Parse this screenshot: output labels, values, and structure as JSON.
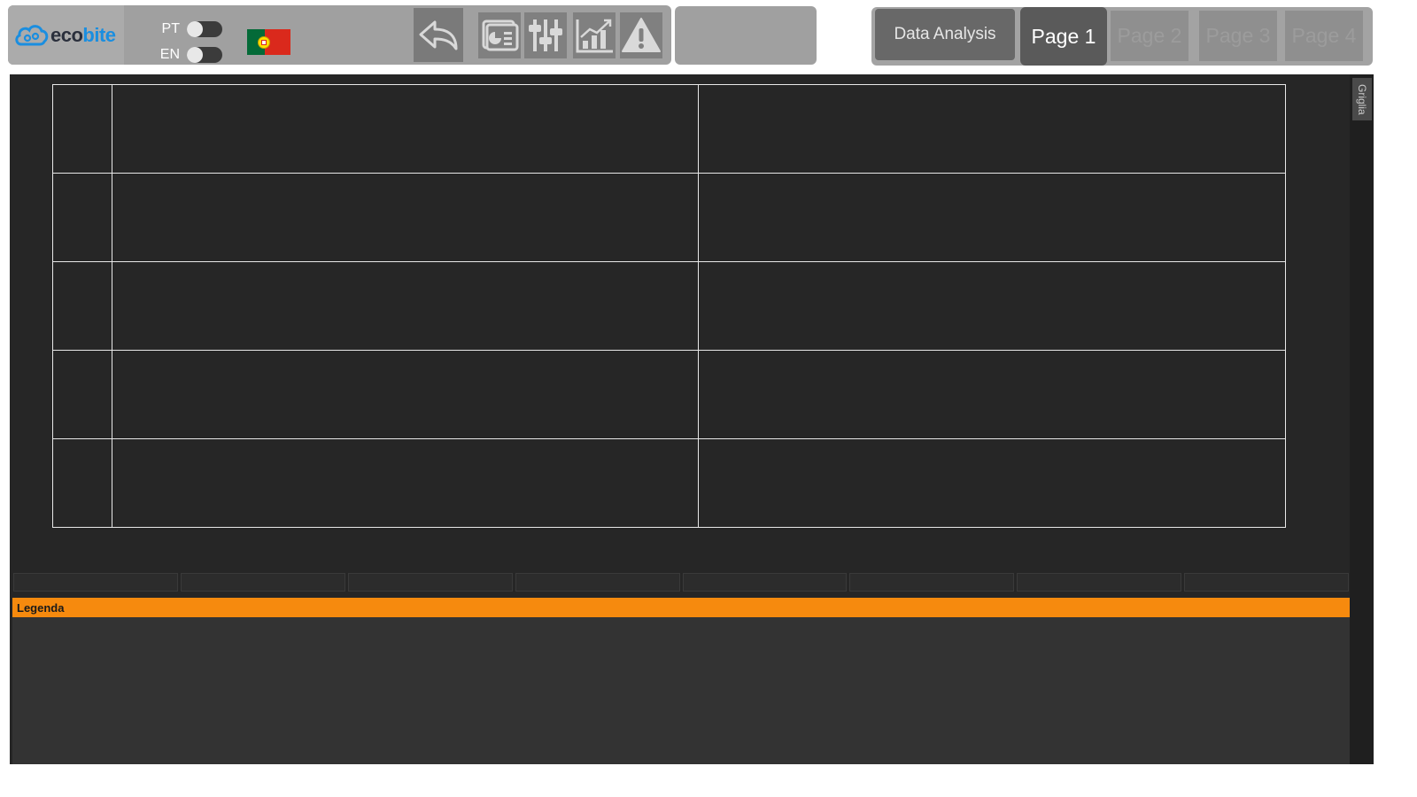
{
  "header": {
    "logo": {
      "eco": "eco",
      "bite": "bite"
    },
    "languages": [
      {
        "code": "PT",
        "enabled": false
      },
      {
        "code": "EN",
        "enabled": false
      }
    ],
    "flag": "portugal-flag",
    "toolbar": {
      "back": "back-arrow-icon",
      "report": "report-slides-icon",
      "settings": "sliders-icon",
      "chart": "growth-chart-icon",
      "alarm": "warning-icon"
    },
    "analysis_label": "Data Analysis",
    "pages": [
      {
        "label": "Page 1",
        "active": true
      },
      {
        "label": "Page 2",
        "active": false
      },
      {
        "label": "Page 3",
        "active": false
      },
      {
        "label": "Page 4",
        "active": false
      }
    ]
  },
  "grid": {
    "side_tab": "Griglia",
    "rows": [
      [
        "",
        "",
        ""
      ],
      [
        "",
        "",
        ""
      ],
      [
        "",
        "",
        ""
      ],
      [
        "",
        "",
        ""
      ],
      [
        "",
        "",
        ""
      ]
    ]
  },
  "legend": {
    "title": "Legenda"
  },
  "colors": {
    "legend_accent": "#f68a0e",
    "brand_blue": "#1a8ee0",
    "background": "#262626"
  }
}
